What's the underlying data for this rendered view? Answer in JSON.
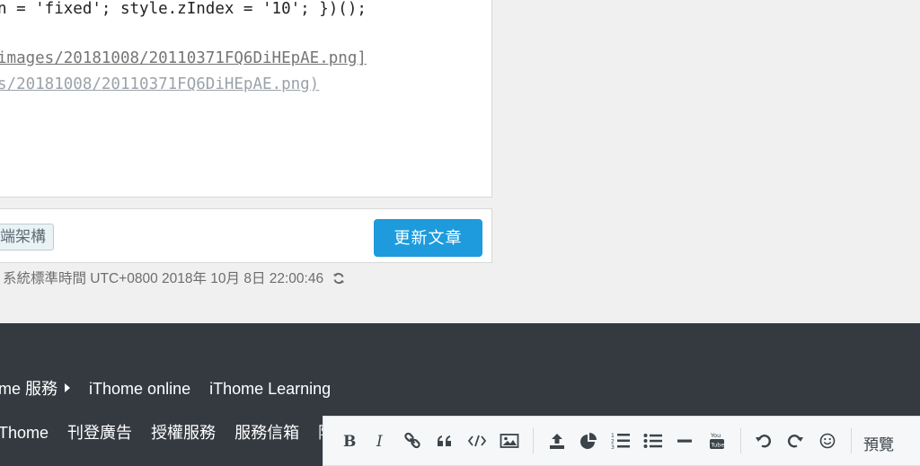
{
  "editor": {
    "code_line_1": "n = 'fixed'; style.zIndex = '10'; })();",
    "code_line_2": "images/20181008/20110371FQ6DiHEpAE.png]",
    "code_line_3": "s/20181008/20110371FQ6DiHEpAE.png)"
  },
  "tags": {
    "chip_label": "端架構"
  },
  "actions": {
    "update_label": "更新文章"
  },
  "status": {
    "timestamp": "系統標準時間 UTC+0800 2018年 10月 8日 22:00:46"
  },
  "footer": {
    "row1": [
      "me 服務",
      "iThome online",
      "iThome Learning"
    ],
    "row2": [
      "Thome",
      "刊登廣告",
      "授權服務",
      "服務信箱",
      "隱"
    ]
  },
  "toolbar": {
    "preview_label": "預覽",
    "buttons": [
      "bold-icon",
      "italic-icon",
      "link-icon",
      "quote-icon",
      "code-icon",
      "image-icon",
      "upload-icon",
      "chart-icon",
      "ordered-list-icon",
      "unordered-list-icon",
      "horizontal-rule-icon",
      "youtube-icon",
      "undo-icon",
      "redo-icon",
      "emoji-icon"
    ]
  },
  "colors": {
    "accent": "#1e9bdc",
    "footer_bg": "#343a40"
  }
}
